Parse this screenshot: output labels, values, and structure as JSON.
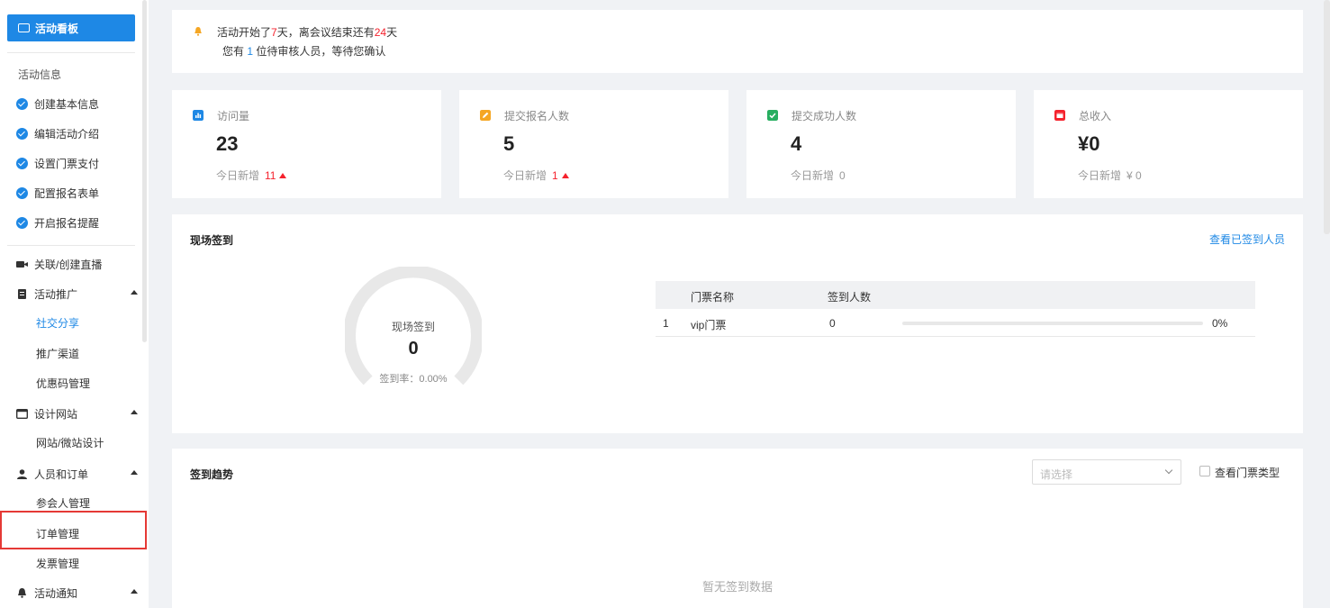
{
  "sidebar": {
    "top_label": "活动看板",
    "section_info": "活动信息",
    "steps": [
      {
        "label": "创建基本信息"
      },
      {
        "label": "编辑活动介绍"
      },
      {
        "label": "设置门票支付"
      },
      {
        "label": "配置报名表单"
      },
      {
        "label": "开启报名提醒"
      }
    ],
    "groups": {
      "live": "关联/创建直播",
      "promo": "活动推广",
      "promo_items": [
        "社交分享",
        "推广渠道",
        "优惠码管理"
      ],
      "site": "设计网站",
      "site_items": [
        "网站/微站设计"
      ],
      "people": "人员和订单",
      "people_items": [
        "参会人管理",
        "订单管理",
        "发票管理"
      ],
      "notify": "活动通知"
    }
  },
  "notice": {
    "line1_a": "活动开始了",
    "started_days": "7",
    "line1_b": "天，离会议结束还有",
    "remaining_days": "24",
    "line1_c": "天",
    "line2_a": "您有 ",
    "pending": "1",
    "line2_b": " 位待审核人员，等待您确认"
  },
  "stats": [
    {
      "label": "访问量",
      "value": "23",
      "today_label": "今日新增",
      "today_value": "11",
      "icon": "chart-icon",
      "color": "#1e88e5"
    },
    {
      "label": "提交报名人数",
      "value": "5",
      "today_label": "今日新增",
      "today_value": "1",
      "icon": "edit-icon",
      "color": "#f5a623"
    },
    {
      "label": "提交成功人数",
      "value": "4",
      "today_label": "今日新增",
      "today_value": "0",
      "icon": "check-icon",
      "color": "#27ae60"
    },
    {
      "label": "总收入",
      "value": "¥0",
      "today_label": "今日新增",
      "today_value": "¥ 0",
      "icon": "calendar-icon",
      "color": "#f5222d"
    }
  ],
  "checkin": {
    "title": "现场签到",
    "link": "查看已签到人员",
    "gauge_label": "现场签到",
    "gauge_value": "0",
    "gauge_rate": "签到率：0.00%",
    "gauge_fill": 0,
    "table": {
      "headers": [
        "门票名称",
        "签到人数"
      ],
      "rows": [
        {
          "index": "1",
          "name": "vip门票",
          "count": "0",
          "percent": "0%",
          "progress": 0
        }
      ]
    }
  },
  "trend": {
    "title": "签到趋势",
    "select_placeholder": "请选择",
    "checkbox_label": "查看门票类型",
    "empty": "暂无签到数据"
  }
}
